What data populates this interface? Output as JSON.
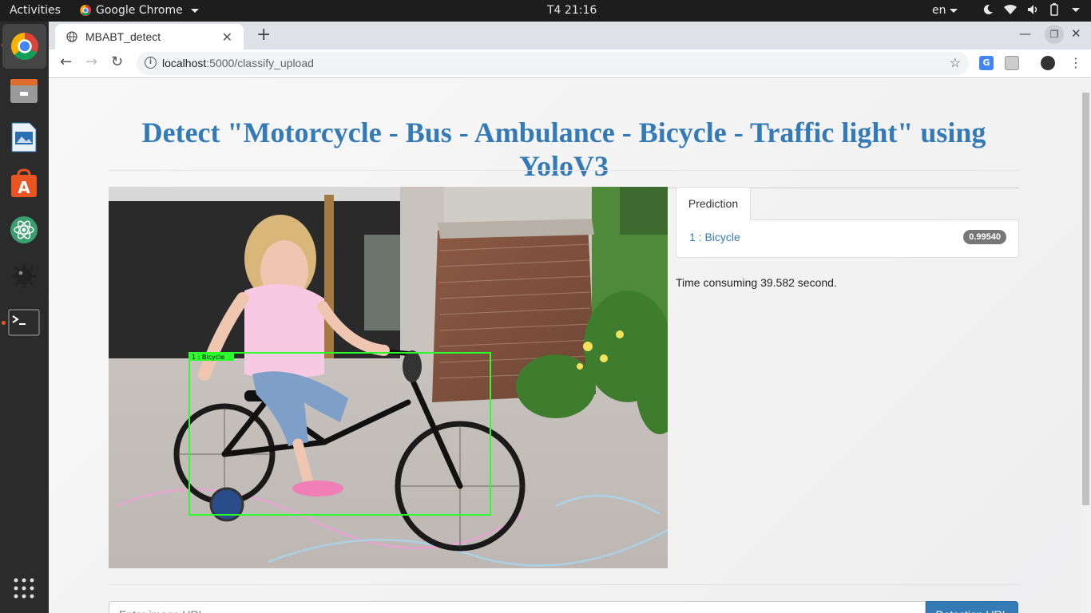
{
  "os": {
    "activities": "Activities",
    "app_menu": "Google Chrome",
    "clock": "T4 21:16",
    "lang": "en"
  },
  "browser": {
    "tab_title": "MBABT_detect",
    "url_host": "localhost",
    "url_path": ":5000/classify_upload"
  },
  "page": {
    "title": "Detect \"Motorcycle - Bus - Ambulance - Bicycle - Traffic light\" using YoloV3",
    "prediction_tab": "Prediction",
    "predictions": [
      {
        "label": "1 : Bicycle",
        "score": "0.99540"
      }
    ],
    "detection_box_label": "1 : Bicycle",
    "time_text": "Time consuming 39.582 second.",
    "url_placeholder": "Enter image URL",
    "detect_button": "Detection URL"
  },
  "colors": {
    "accent": "#337ab7",
    "box": "#2bff2b"
  }
}
